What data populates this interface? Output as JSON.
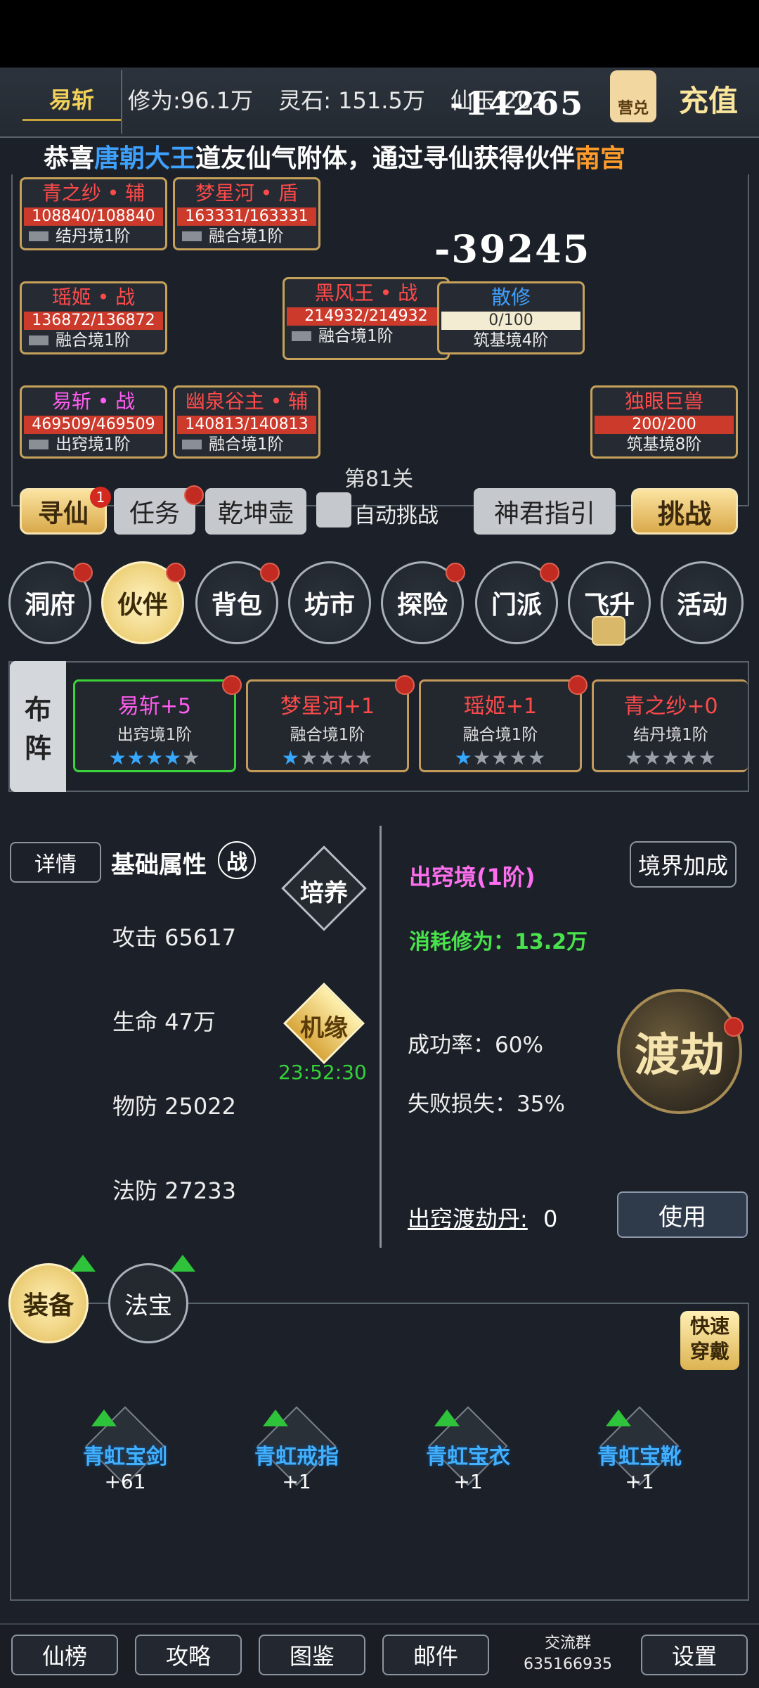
{
  "topbar": {
    "player_name": "易斩",
    "cultivation": "修为:96.1万",
    "spirit_stones": "灵石: 151.5万",
    "immortal_jade": "仙玉:202",
    "floating_damage": "-14265",
    "recharge_icon_text": "营兑",
    "recharge_label": "充值"
  },
  "marquee": {
    "prefix": "恭喜",
    "player": "唐朝大王",
    "middle": "道友仙气附体，通过寻仙获得伙伴",
    "partner": "南宫"
  },
  "battle": {
    "floating_damage": "-39245",
    "stage": "第81关",
    "allies": [
      {
        "name": "青之纱 • 辅",
        "hp": "108840/108840",
        "realm": "结丹境1阶",
        "name_color": "#ff4a4a"
      },
      {
        "name": "梦星河 • 盾",
        "hp": "163331/163331",
        "realm": "融合境1阶",
        "name_color": "#ff4a4a"
      },
      {
        "name": "瑶姬 • 战",
        "hp": "136872/136872",
        "realm": "融合境1阶",
        "name_color": "#ff4a4a"
      },
      {
        "name": "黑风王 • 战",
        "hp": "214932/214932",
        "realm": "融合境1阶",
        "name_color": "#ff4a4a"
      },
      {
        "name": "易斩 • 战",
        "hp": "469509/469509",
        "realm": "出窍境1阶",
        "name_color": "#ff5cf0"
      },
      {
        "name": "幽泉谷主 • 辅",
        "hp": "140813/140813",
        "realm": "融合境1阶",
        "name_color": "#ff4a4a"
      }
    ],
    "enemies": [
      {
        "name": "散修",
        "hp": "0/100",
        "realm": "筑基境4阶",
        "name_color": "#3ea0ff"
      },
      {
        "name": "独眼巨兽",
        "hp": "200/200",
        "realm": "筑基境8阶",
        "name_color": "#ff4a4a"
      }
    ]
  },
  "actions": {
    "seek_immortal": "寻仙",
    "seek_badge": "1",
    "task": "任务",
    "qiankun": "乾坤壶",
    "auto_battle": "自动挑战",
    "guide": "神君指引",
    "challenge": "挑战"
  },
  "nav": [
    "洞府",
    "伙伴",
    "背包",
    "坊市",
    "探险",
    "门派",
    "飞升",
    "活动"
  ],
  "formation": {
    "label_line1": "布",
    "label_line2": "阵",
    "cards": [
      {
        "name": "易斩+5",
        "realm": "出窍境1阶",
        "stars_on": 4,
        "color": "#ff5cf0"
      },
      {
        "name": "梦星河+1",
        "realm": "融合境1阶",
        "stars_on": 1,
        "color": "#ff4a4a"
      },
      {
        "name": "瑶姬+1",
        "realm": "融合境1阶",
        "stars_on": 1,
        "color": "#ff4a4a"
      },
      {
        "name": "青之纱+0",
        "realm": "结丹境1阶",
        "stars_on": 0,
        "color": "#ff4a4a"
      }
    ]
  },
  "attributes": {
    "details_btn": "详情",
    "title": "基础属性",
    "class_icon": "战",
    "attack": "攻击 65617",
    "hp": "生命 47万",
    "phys_def": "物防 25022",
    "magic_def": "法防 27233",
    "train": "培养",
    "fortune": "机缘",
    "timer": "23:52:30"
  },
  "realm": {
    "title": "出窍境(1阶)",
    "bonus_btn": "境界加成",
    "consume": "消耗修为：13.2万",
    "success": "成功率：60%",
    "fail": "失败损失：35%",
    "dujie": "渡劫",
    "pill_label": "出窍渡劫丹:",
    "pill_count": "0",
    "use_btn": "使用"
  },
  "equipment": {
    "tab_equip": "装备",
    "tab_treasure": "法宝",
    "quick_wear_1": "快速",
    "quick_wear_2": "穿戴",
    "items": [
      {
        "name": "青虹宝剑",
        "level": "+61"
      },
      {
        "name": "青虹戒指",
        "level": "+1"
      },
      {
        "name": "青虹宝衣",
        "level": "+1"
      },
      {
        "name": "青虹宝靴",
        "level": "+1"
      }
    ]
  },
  "bottom": {
    "rank": "仙榜",
    "guide": "攻略",
    "atlas": "图鉴",
    "mail": "邮件",
    "group_label": "交流群",
    "group_id": "635166935",
    "settings": "设置"
  }
}
